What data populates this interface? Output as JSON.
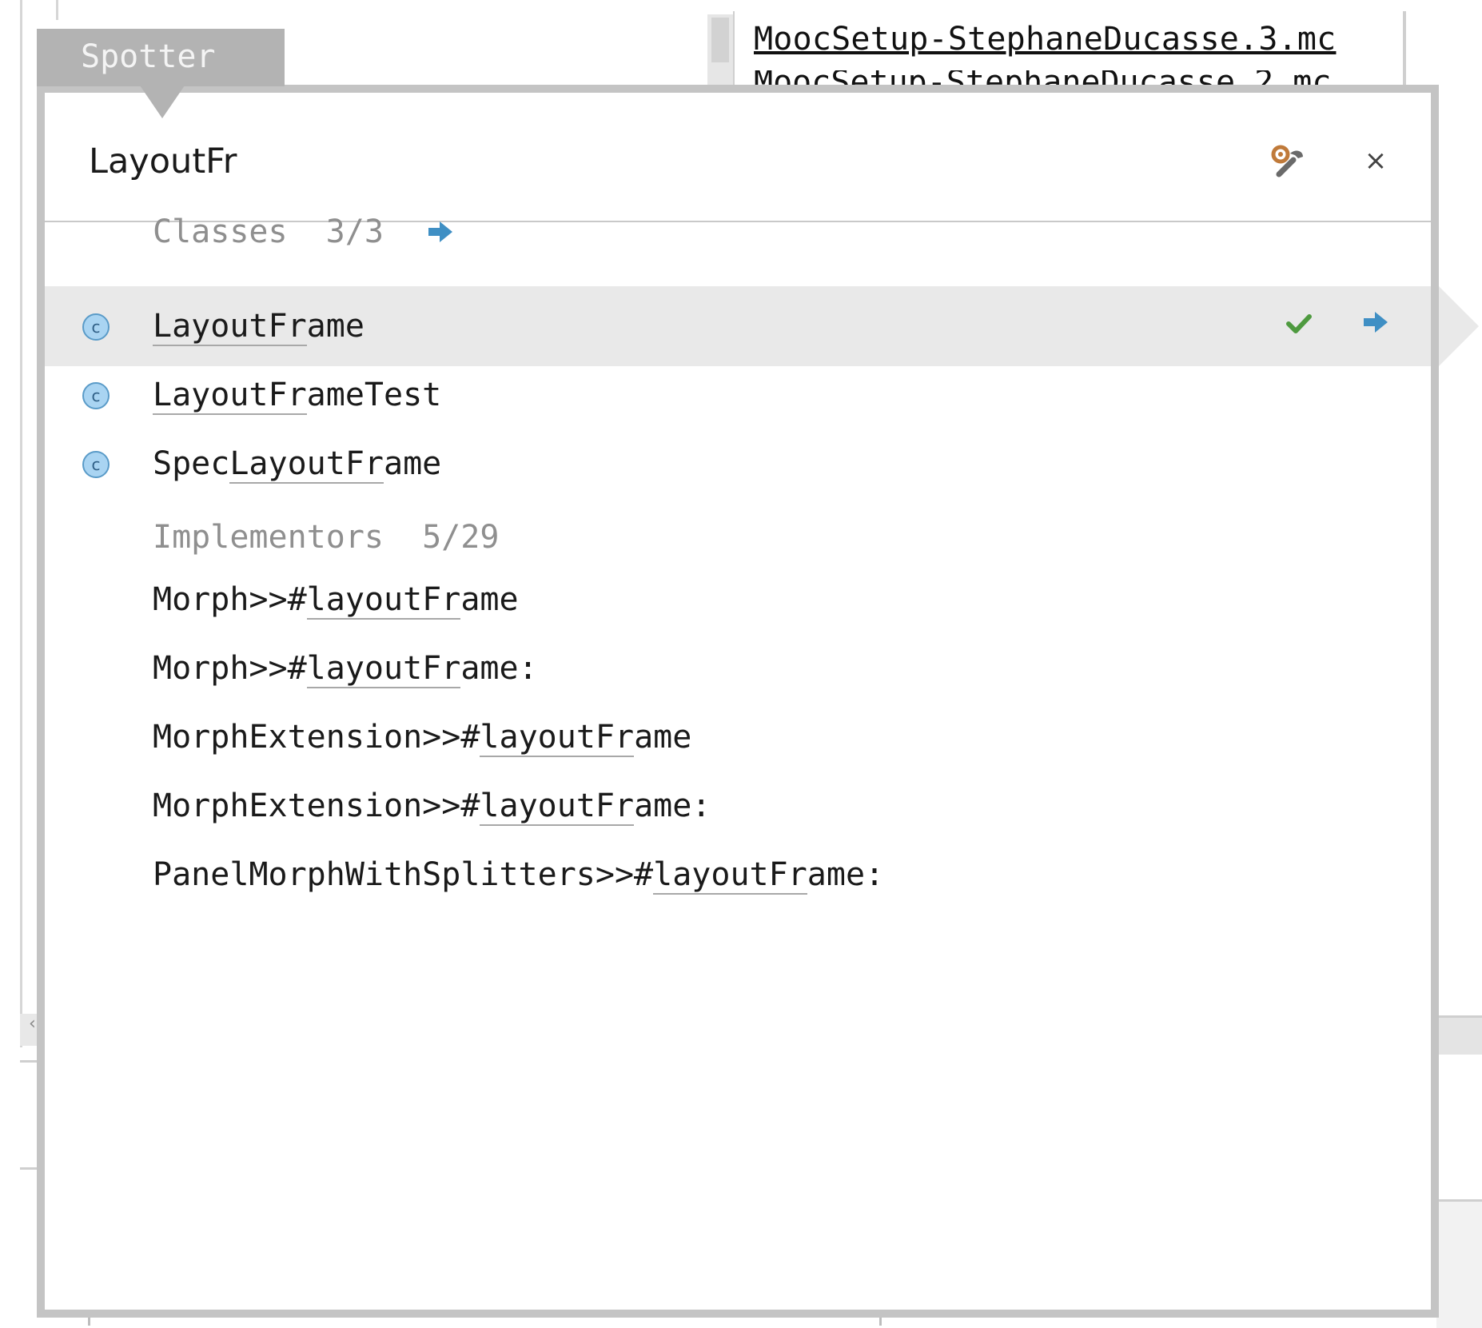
{
  "background": {
    "file_links": [
      "MoocSetup-StephaneDucasse.3.mc",
      "MoocSetup-StephaneDucasse.2.mc"
    ]
  },
  "spotter": {
    "tab_label": "Spotter",
    "search": {
      "value": "LayoutFr",
      "placeholder": ""
    },
    "icons": {
      "settings": "wrench-gear-icon",
      "close": "close-icon",
      "close_glyph": "×"
    },
    "categories": [
      {
        "name": "Classes",
        "count": "3/3",
        "items": [
          {
            "pre": "",
            "match": "LayoutFr",
            "post": "ame",
            "selected": true
          },
          {
            "pre": "",
            "match": "LayoutFr",
            "post": "ameTest",
            "selected": false
          },
          {
            "pre": "Spec",
            "match": "LayoutFr",
            "post": "ame",
            "selected": false
          }
        ]
      },
      {
        "name": "Implementors",
        "count": "5/29",
        "items": [
          {
            "pre": "Morph>>#",
            "match": "layoutFr",
            "post": "ame"
          },
          {
            "pre": "Morph>>#",
            "match": "layoutFr",
            "post": "ame:"
          },
          {
            "pre": "MorphExtension>>#",
            "match": "layoutFr",
            "post": "ame"
          },
          {
            "pre": "MorphExtension>>#",
            "match": "layoutFr",
            "post": "ame:"
          },
          {
            "pre": "PanelMorphWithSplitters>>#",
            "match": "layoutFr",
            "post": "ame:"
          }
        ]
      }
    ]
  },
  "colors": {
    "accent_arrow": "#3f8fc4",
    "check_green": "#4e9a3f",
    "class_icon_fill": "#a9d4f2",
    "selection_bg": "#e9e9e9",
    "panel_border": "#c4c4c4"
  }
}
